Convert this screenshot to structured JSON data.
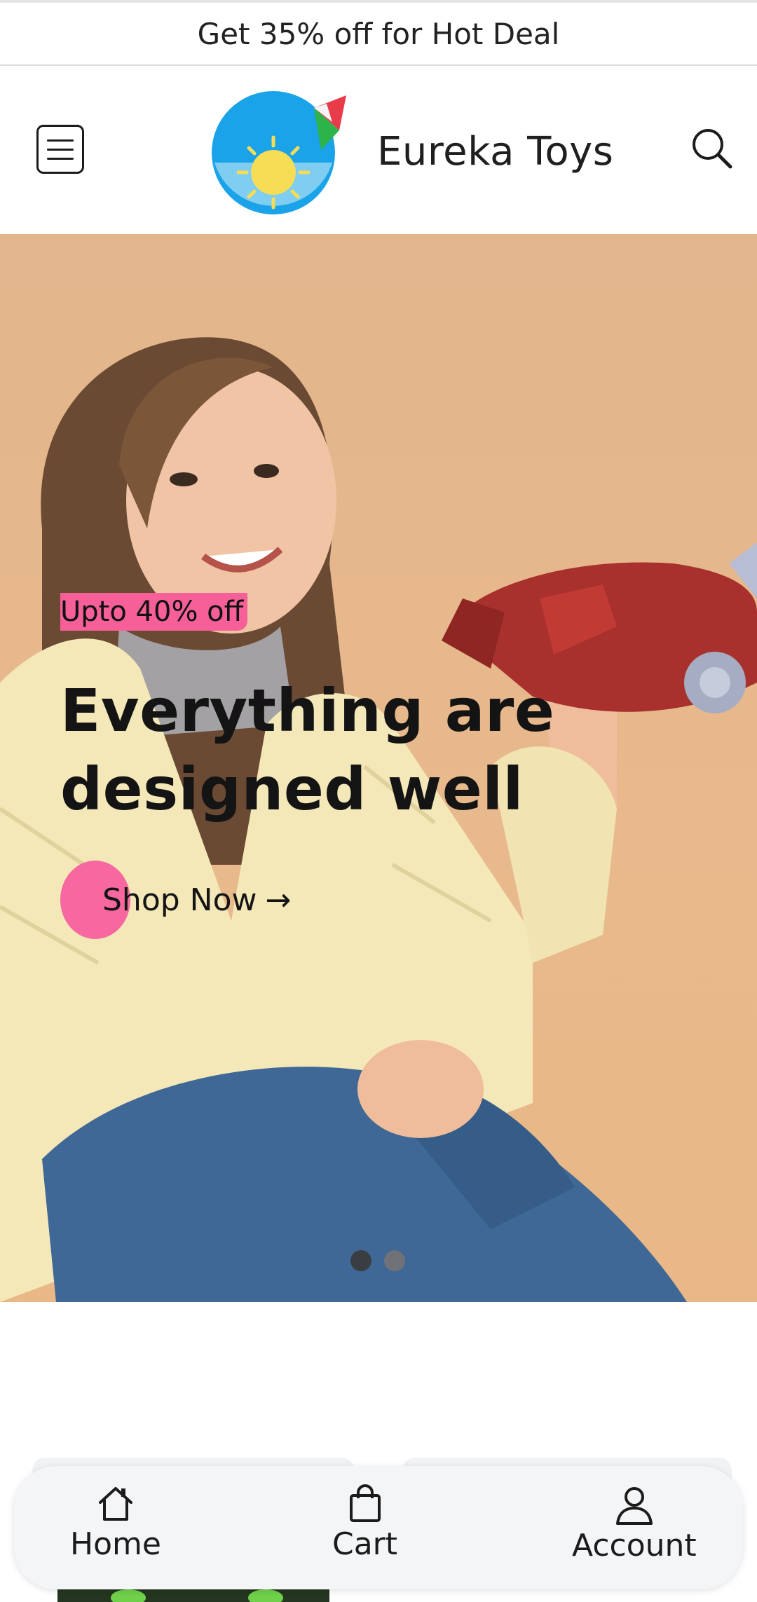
{
  "announcement": {
    "text": "Get 35% off for Hot Deal"
  },
  "header": {
    "brand": "Eureka Toys",
    "menu_icon": "menu-icon",
    "search_icon": "search-icon",
    "logo_icon": "sun-kite-logo"
  },
  "hero": {
    "promo_tag": "Upto 40% off",
    "headline": "Everything are designed well",
    "cta_label": "Shop Now",
    "cta_arrow": "→",
    "slides": 2,
    "active_slide": 1
  },
  "bottom_nav": {
    "items": [
      {
        "label": "Home",
        "icon": "home-icon"
      },
      {
        "label": "Cart",
        "icon": "bag-icon"
      },
      {
        "label": "Account",
        "icon": "user-icon"
      }
    ]
  },
  "colors": {
    "accent_pink": "#f65f97",
    "hero_bg": "#e6b88b",
    "nav_bg": "#f4f5f7"
  }
}
